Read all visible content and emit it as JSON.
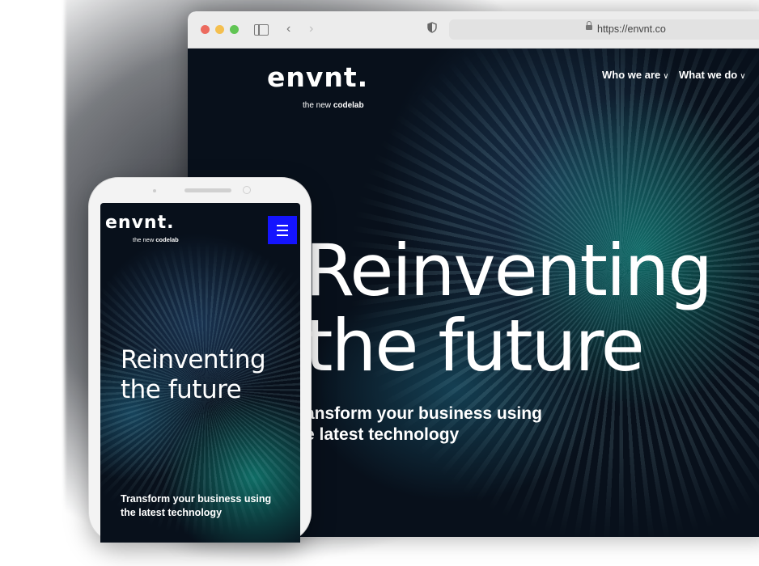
{
  "browser": {
    "url": "https://envnt.co"
  },
  "desktop_site": {
    "logo": "envnt.",
    "tagline_prefix": "the new ",
    "tagline_bold": "codelab",
    "nav": [
      {
        "label": "Who we are"
      },
      {
        "label": "What we do"
      }
    ],
    "hero_title_line1": "Reinventing",
    "hero_title_line2": "the future",
    "hero_sub_line1": "ansform your business using",
    "hero_sub_line2": "e latest technology"
  },
  "mobile_site": {
    "logo": "envnt.",
    "tagline_prefix": "the new ",
    "tagline_bold": "codelab",
    "hero_title_line1": "Reinventing",
    "hero_title_line2": "the future",
    "hero_sub_line1": "Transform your business using",
    "hero_sub_line2": "the latest technology",
    "menu_button_color": "#1414ff"
  },
  "icons": {
    "menu": "hamburger-icon",
    "nav_chevron": "chevron-down-icon",
    "back": "chevron-left-icon",
    "forward": "chevron-right-icon",
    "privacy": "shield-icon",
    "lock": "lock-icon",
    "sidebar": "sidebar-icon"
  }
}
